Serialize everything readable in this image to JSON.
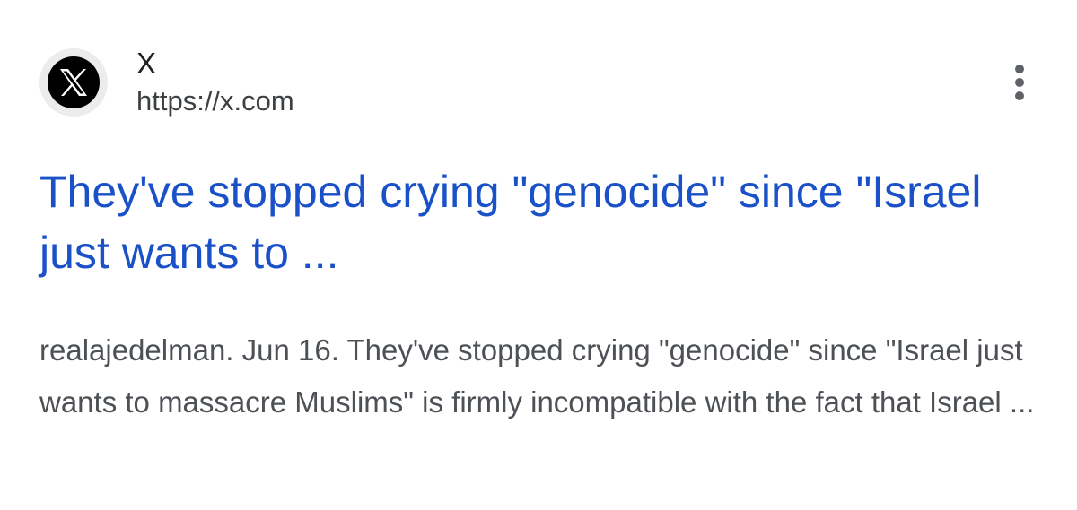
{
  "result": {
    "source": {
      "name": "X",
      "url": "https://x.com",
      "favicon_icon": "x-logo-icon"
    },
    "more_icon": "more-vert-icon",
    "title": "They've stopped crying \"genocide\" since \"Israel just wants to ...",
    "snippet": "realajedelman. Jun 16. They've stopped crying \"genocide\" since \"Israel just wants to massacre Muslims\" is firmly incompatible with the fact that Israel ...",
    "colors": {
      "title_link": "#1a51c8",
      "snippet_text": "#4d5156",
      "source_name": "#202124"
    }
  }
}
